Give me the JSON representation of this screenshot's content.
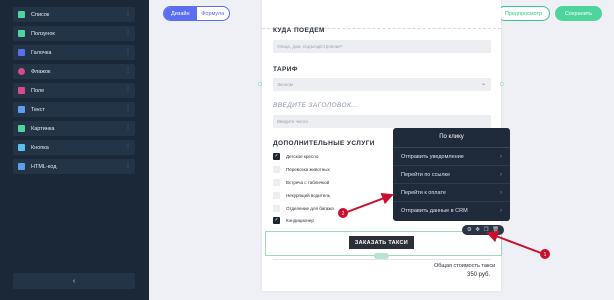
{
  "sidebar": {
    "items": [
      {
        "label": "Список",
        "icon": "list-icon",
        "color": "#4fd59c"
      },
      {
        "label": "Ползунок",
        "icon": "slider-icon",
        "color": "#4fd59c"
      },
      {
        "label": "Галочка",
        "icon": "checkbox-icon",
        "color": "#5b6ef0"
      },
      {
        "label": "Флажок",
        "icon": "radio-icon",
        "color": "#e0468b"
      },
      {
        "label": "Поле",
        "icon": "field-icon",
        "color": "#e0468b"
      },
      {
        "label": "Текст",
        "icon": "text-icon",
        "color": "#5b9ef0"
      },
      {
        "label": "Картинка",
        "icon": "image-icon",
        "color": "#4fd59c"
      },
      {
        "label": "Кнопка",
        "icon": "button-icon",
        "color": "#5bc0f0"
      },
      {
        "label": "HTML-код",
        "icon": "html-icon",
        "color": "#5b9ef0"
      }
    ],
    "collapse_label": "‹"
  },
  "header": {
    "tab_design": "Дизайн",
    "tab_formula": "Формула",
    "preview": "Предпросмотр",
    "save": "Сохранить"
  },
  "form": {
    "where_title": "КУДА ПОЕДЕМ",
    "where_placeholder": "Улица, дом, подъезд/строение*",
    "tariff_title": "ТАРИФ",
    "tariff_value": "Эконом",
    "heading_placeholder": "ВВЕДИТЕ ЗАГОЛОВОК...",
    "text_placeholder": "Введите число",
    "extras_title": "ДОПОЛНИТЕЛЬНЫЕ УСЛУГИ",
    "extras": [
      {
        "label": "Детское кресло",
        "checked": true
      },
      {
        "label": "Перевозка животных",
        "checked": false
      },
      {
        "label": "Встреча с табличкой",
        "checked": false
      },
      {
        "label": "Некурящий водитель",
        "checked": false
      },
      {
        "label": "Отделение для багажа",
        "checked": false
      },
      {
        "label": "Кондиционер",
        "checked": true
      }
    ],
    "order_button": "ЗАКАЗАТЬ ТАКСИ",
    "total_label": "Общая стоимость такси",
    "total_value": "350 руб."
  },
  "popup": {
    "title": "По клику",
    "items": [
      "Отправить уведомление",
      "Перейти по ссылке",
      "Перейти к оплате",
      "Отправить данные в CRM"
    ]
  },
  "annotations": [
    {
      "label": "2",
      "color": "#c8102e"
    },
    {
      "label": "1",
      "color": "#c8102e"
    }
  ],
  "colors": {
    "sidebar_bg": "#1b2838",
    "accent_blue": "#5b6ef0",
    "accent_green": "#4fd59c",
    "annotation_red": "#c8102e"
  }
}
